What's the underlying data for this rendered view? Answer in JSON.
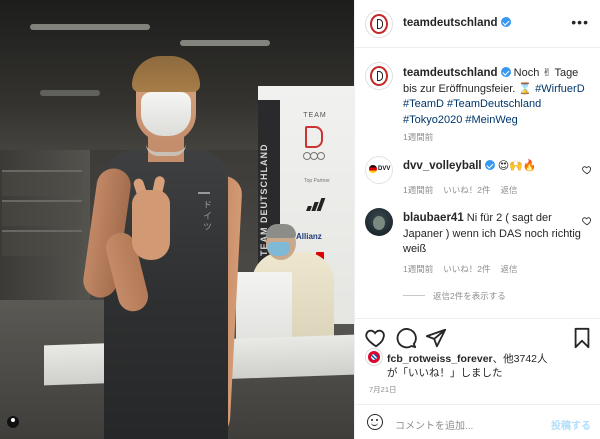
{
  "post": {
    "author": "teamdeutschland",
    "header_more": "•••"
  },
  "caption": {
    "author": "teamdeutschland",
    "text_part1": " Noch ",
    "text_part2": " Tage bis zur Eröffnungsfeier. ",
    "hashtags": [
      "#WirfuerD",
      "#TeamD",
      "#TeamDeutschland",
      "#Tokyo2020",
      "#MeinWeg"
    ],
    "time": "1週間前"
  },
  "comments": [
    {
      "user": "dvv_volleyball",
      "text": "",
      "emojis": "😍🙌🔥",
      "time": "1週間前",
      "likes": "いいね！2件",
      "reply": "返信"
    },
    {
      "user": "blaubaer41",
      "text": "Ni für 2 ( sagt der Japaner ) wenn ich DAS noch richtig weiß",
      "time": "1週間前",
      "likes": "いいね！2件",
      "reply": "返信"
    }
  ],
  "view_replies": "返信2件を表示する",
  "likes_line": {
    "user": "fcb_rotweiss_forever",
    "rest": "、他3742人",
    "line2": "が「いいね！」しました"
  },
  "post_date": "7月21日",
  "comment_input": {
    "placeholder": "コメントを追加...",
    "post_button": "投稿する"
  },
  "photo": {
    "banner_vertical": "TEAM DEUTSCHLAND",
    "banner_team": "TEAM",
    "banner_partner": "Top Partner",
    "banner_allianz": "Allianz",
    "shirt_text": "ドイツ"
  },
  "colors": {
    "link": "#00376b",
    "verified": "#3897f0",
    "muted": "#8e8e8e",
    "post_button": "#b2dffc"
  }
}
